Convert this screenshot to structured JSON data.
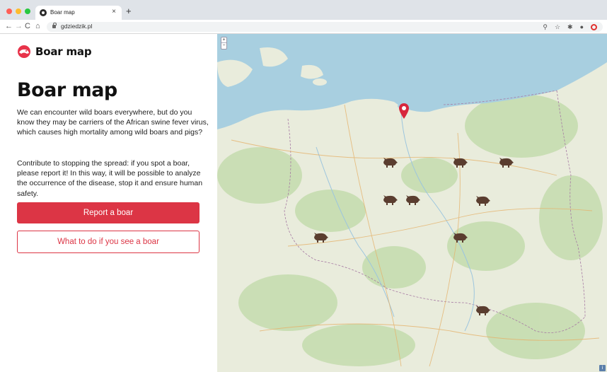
{
  "browser": {
    "tab_title": "Boar map",
    "tab_close": "×",
    "new_tab": "+",
    "url": "gdziedzik.pl",
    "nav": {
      "back": "←",
      "forward": "→",
      "reload": "C",
      "home": "⌂"
    }
  },
  "sidebar": {
    "brand_name": "Boar map",
    "title": "Boar map",
    "intro": "We can encounter wild boars everywhere, but do you know they may be carriers of the African swine fever virus, which causes high mortality among wild boars and pigs?",
    "cta_text": "Contribute to stopping the spread: if you spot a boar, please report it! In this way, it will be possible to analyze the occurrence of the disease, stop it and ensure human safety.",
    "report_button": "Report a boar",
    "info_button": "What to do if you see a boar"
  },
  "map": {
    "zoom_in": "+",
    "zoom_out": "−",
    "info": "i",
    "colors": {
      "sea": "#a8cfe0",
      "land": "#e9ecdc",
      "forest": "#bfd8a3",
      "marker": "#d7263d",
      "boar": "#5a3d2f"
    },
    "boar_count": 10
  }
}
